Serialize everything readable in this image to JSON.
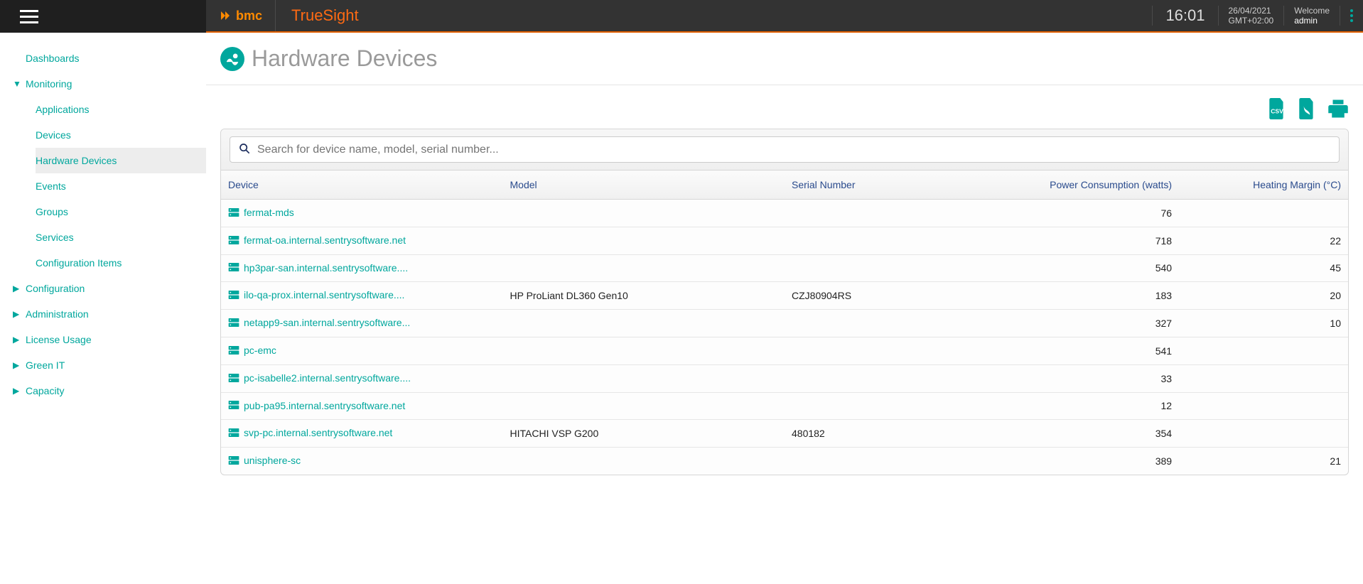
{
  "header": {
    "product": "TrueSight",
    "clock": "16:01",
    "date": "26/04/2021",
    "timezone": "GMT+02:00",
    "welcome_label": "Welcome",
    "username": "admin"
  },
  "sidebar": {
    "dashboards": "Dashboards",
    "monitoring": "Monitoring",
    "monitoring_children": {
      "applications": "Applications",
      "devices": "Devices",
      "hardware_devices": "Hardware Devices",
      "events": "Events",
      "groups": "Groups",
      "services": "Services",
      "configuration_items": "Configuration Items"
    },
    "configuration": "Configuration",
    "administration": "Administration",
    "license_usage": "License Usage",
    "green_it": "Green IT",
    "capacity": "Capacity"
  },
  "page": {
    "title": "Hardware Devices",
    "search_placeholder": "Search for device name, model, serial number..."
  },
  "columns": {
    "device": "Device",
    "model": "Model",
    "serial": "Serial Number",
    "power": "Power Consumption (watts)",
    "heat": "Heating Margin (°C)"
  },
  "rows": [
    {
      "device": "fermat-mds",
      "model": "",
      "serial": "",
      "power": "76",
      "heat": ""
    },
    {
      "device": "fermat-oa.internal.sentrysoftware.net",
      "model": "",
      "serial": "",
      "power": "718",
      "heat": "22"
    },
    {
      "device": "hp3par-san.internal.sentrysoftware....",
      "model": "",
      "serial": "",
      "power": "540",
      "heat": "45"
    },
    {
      "device": "ilo-qa-prox.internal.sentrysoftware....",
      "model": "HP ProLiant DL360 Gen10",
      "serial": "CZJ80904RS",
      "power": "183",
      "heat": "20"
    },
    {
      "device": "netapp9-san.internal.sentrysoftware...",
      "model": "",
      "serial": "",
      "power": "327",
      "heat": "10"
    },
    {
      "device": "pc-emc",
      "model": "",
      "serial": "",
      "power": "541",
      "heat": ""
    },
    {
      "device": "pc-isabelle2.internal.sentrysoftware....",
      "model": "",
      "serial": "",
      "power": "33",
      "heat": ""
    },
    {
      "device": "pub-pa95.internal.sentrysoftware.net",
      "model": "",
      "serial": "",
      "power": "12",
      "heat": ""
    },
    {
      "device": "svp-pc.internal.sentrysoftware.net",
      "model": "HITACHI VSP G200",
      "serial": "480182",
      "power": "354",
      "heat": ""
    },
    {
      "device": "unisphere-sc",
      "model": "",
      "serial": "",
      "power": "389",
      "heat": "21"
    }
  ]
}
